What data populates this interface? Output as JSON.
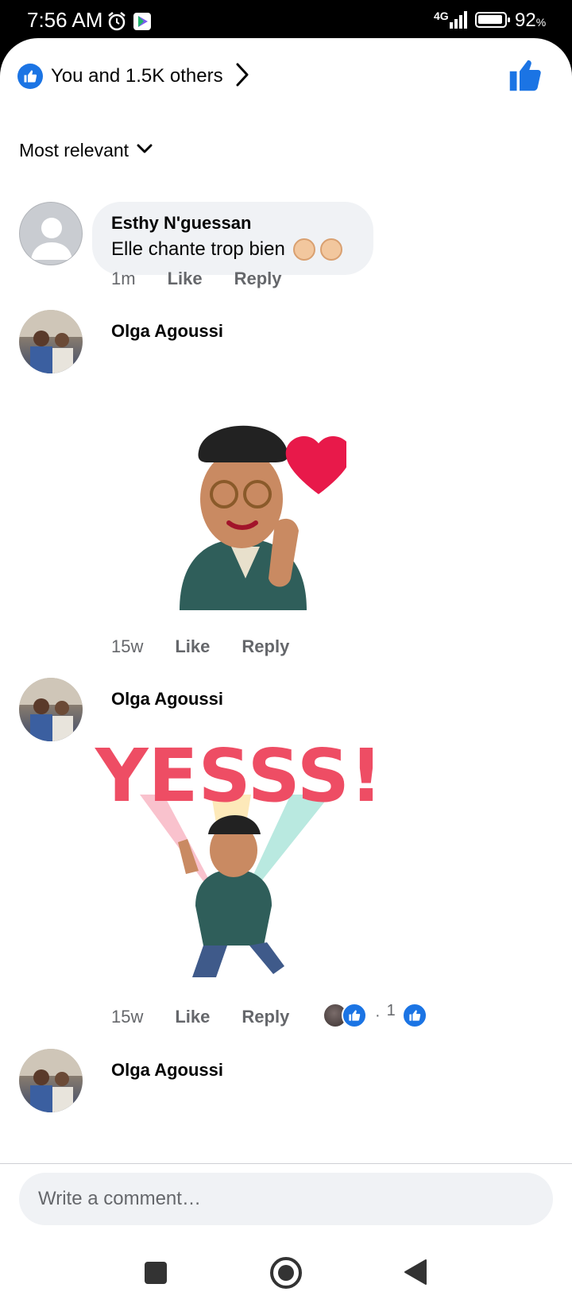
{
  "status_bar": {
    "time": "7:56 AM",
    "network": "4G",
    "battery_pct": "92",
    "battery_unit": "%"
  },
  "header": {
    "reactions_text": "You and 1.5K others"
  },
  "sort": {
    "label": "Most relevant"
  },
  "comments": [
    {
      "author": "Esthy N'guessan",
      "text": "Elle chante trop bien",
      "time": "1m",
      "like": "Like",
      "reply": "Reply"
    },
    {
      "author": "Olga Agoussi",
      "sticker": "heart-hands-avatar",
      "time": "15w",
      "like": "Like",
      "reply": "Reply"
    },
    {
      "author": "Olga Agoussi",
      "sticker": "yesss-avatar",
      "sticker_text": "YESSS!",
      "time": "15w",
      "like": "Like",
      "reply": "Reply",
      "reaction_dot": "·",
      "reaction_count": "1"
    },
    {
      "author": "Olga Agoussi"
    }
  ],
  "composer": {
    "placeholder": "Write a comment…"
  },
  "colors": {
    "accent": "#1b74e4",
    "bubble": "#f0f2f5",
    "secondary_text": "#65676b"
  }
}
